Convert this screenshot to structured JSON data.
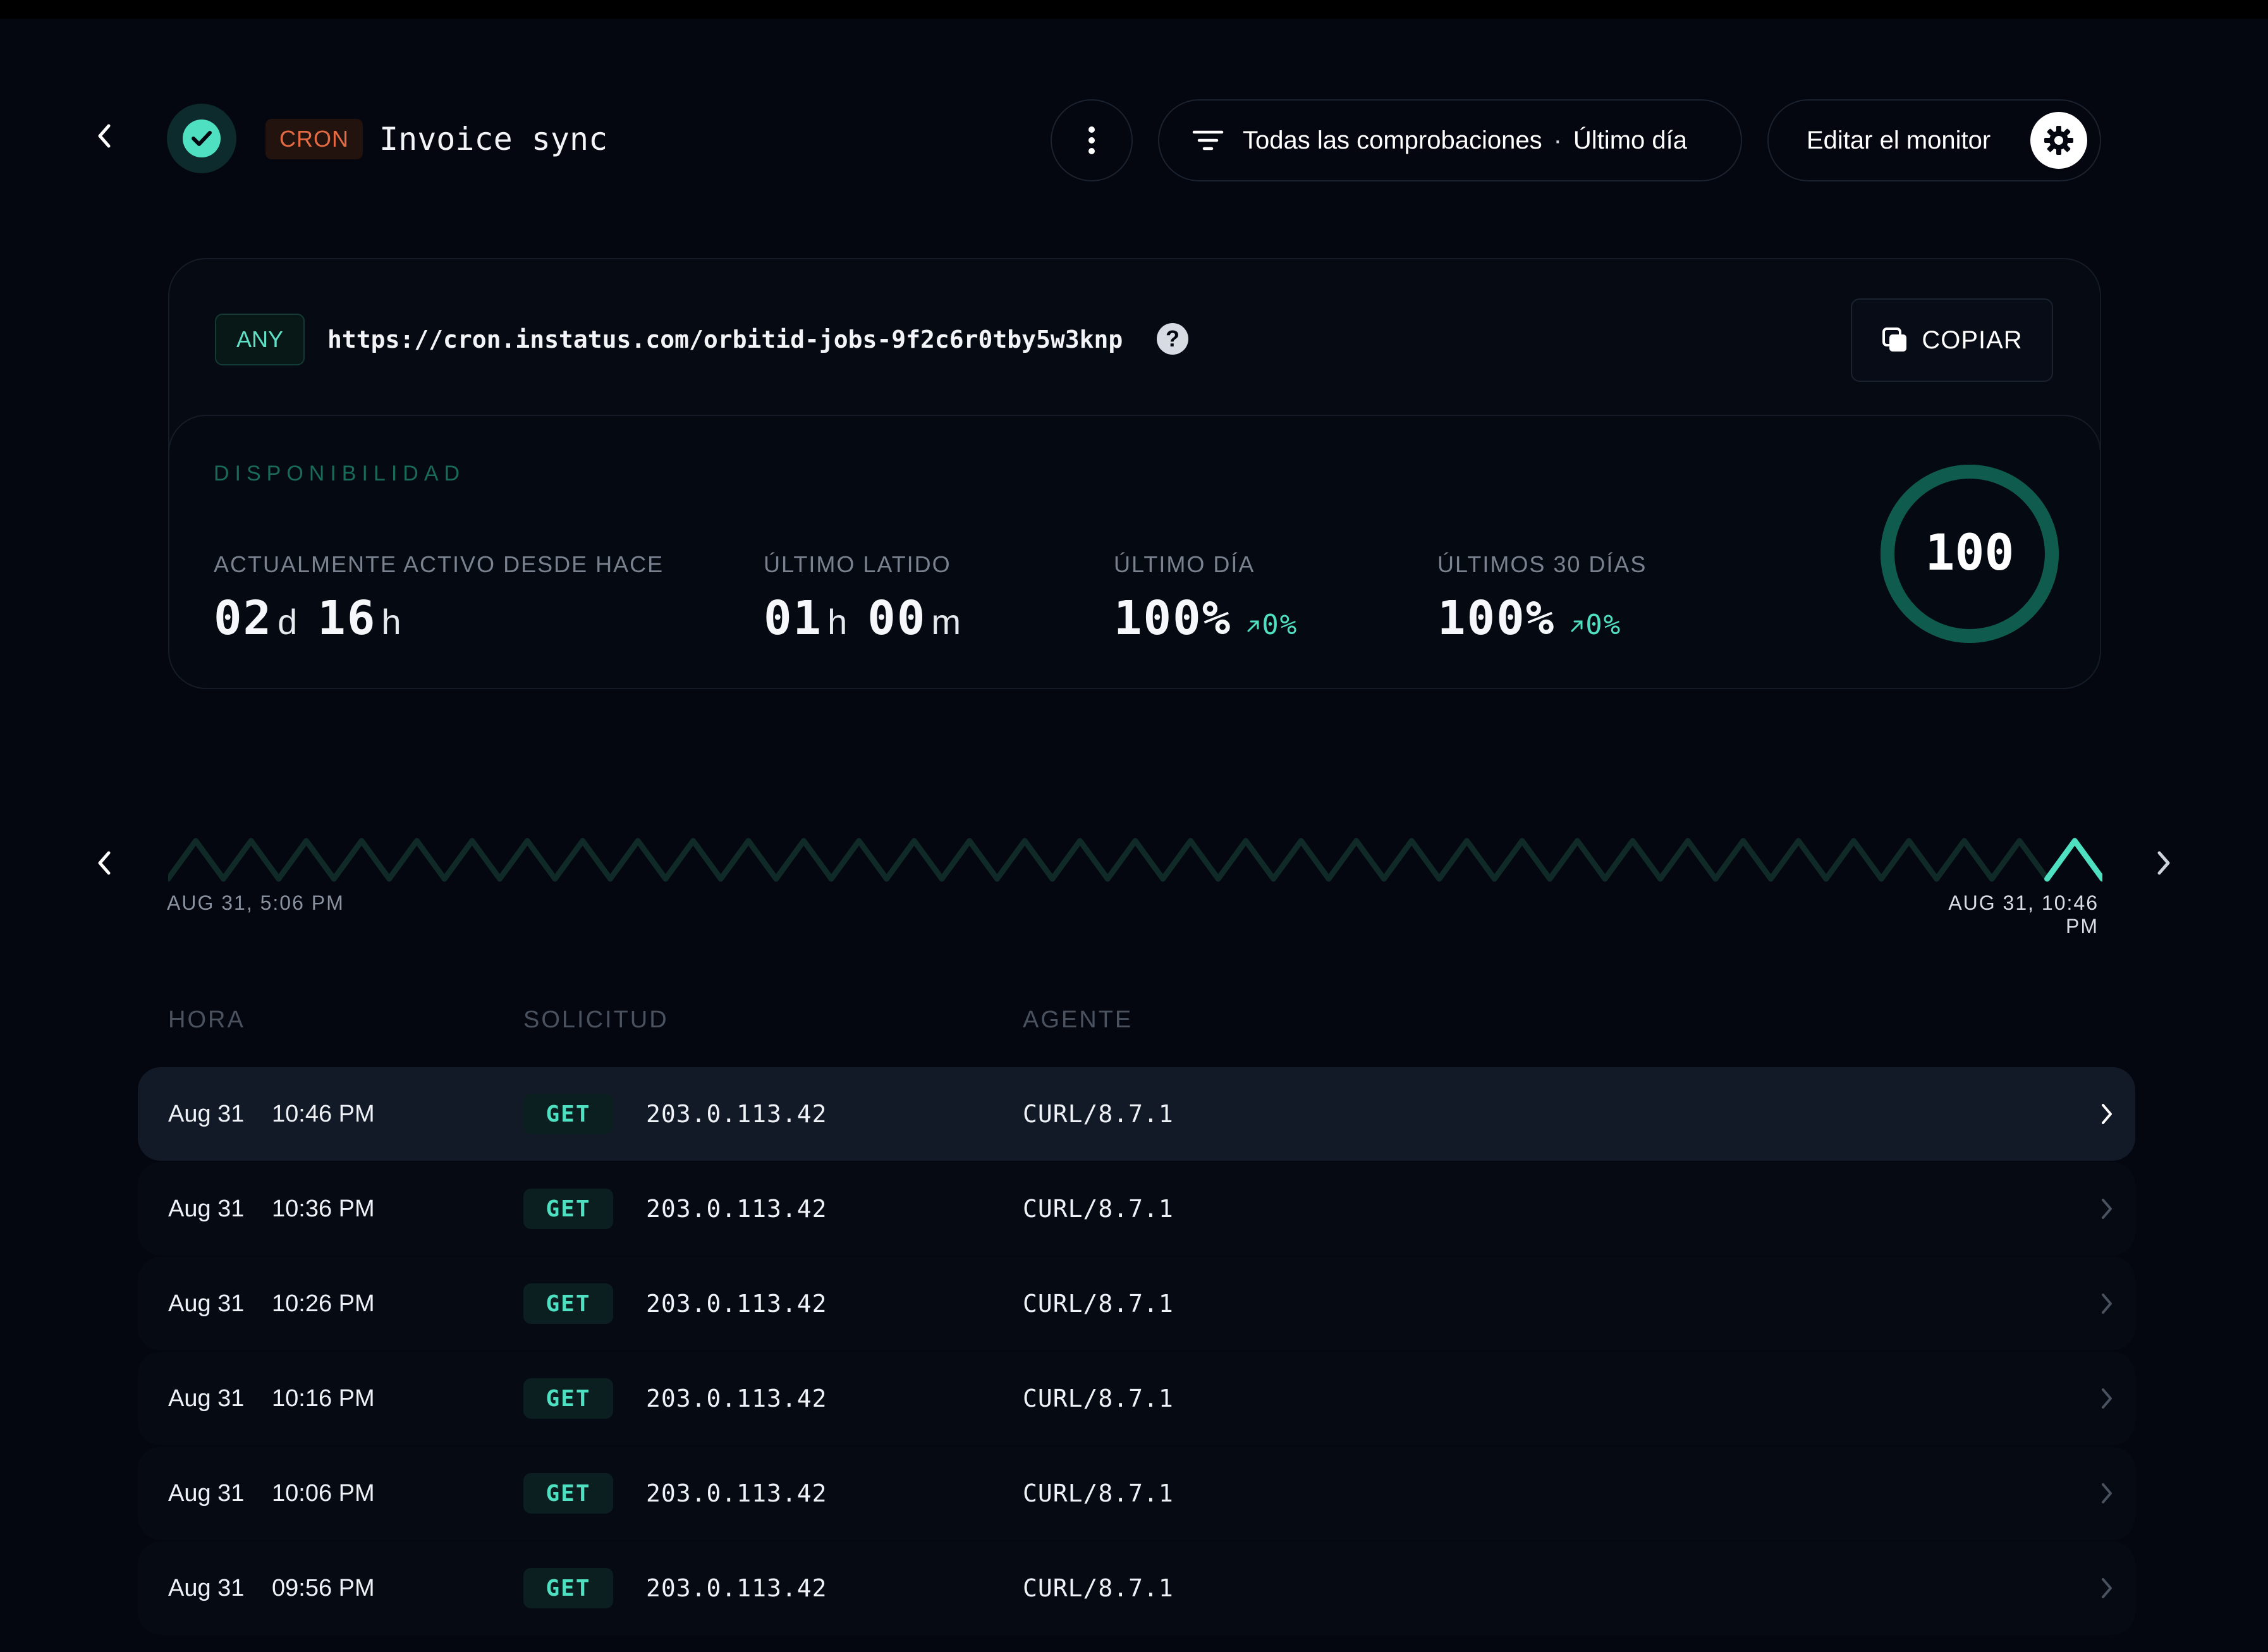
{
  "header": {
    "status": "up",
    "type_badge": "CRON",
    "title": "Invoice sync",
    "filter": {
      "scope": "Todas las comprobaciones",
      "separator": "·",
      "range": "Último día"
    },
    "edit_label": "Editar el monitor"
  },
  "endpoint": {
    "method_badge": "ANY",
    "url": "https://cron.instatus.com/orbitid-jobs-9f2c6r0tby5w3knp",
    "help_symbol": "?",
    "copy_label": "COPIAR"
  },
  "availability": {
    "section_label": "DISPONIBILIDAD",
    "active_since": {
      "label": "ACTUALMENTE ACTIVO DESDE HACE",
      "days": "02",
      "days_unit": "d",
      "hours": "16",
      "hours_unit": "h"
    },
    "last_heartbeat": {
      "label": "ÚLTIMO LATIDO",
      "hours": "01",
      "hours_unit": "h",
      "minutes": "00",
      "minutes_unit": "m"
    },
    "last_day": {
      "label": "ÚLTIMO DÍA",
      "value": "100%",
      "delta": "0%"
    },
    "last_30_days": {
      "label": "ÚLTIMOS 30 DÍAS",
      "value": "100%",
      "delta": "0%"
    },
    "gauge_value": "100",
    "gauge_fraction": 1.0
  },
  "timeline": {
    "start_label": "AUG 31, 5:06 PM",
    "end_label": "AUG 31, 10:46 PM",
    "beat_count": 35,
    "highlighted_beat": "last"
  },
  "table": {
    "headers": {
      "time": "HORA",
      "request": "SOLICITUD",
      "agent": "AGENTE"
    },
    "rows": [
      {
        "date": "Aug 31",
        "time": "10:46 PM",
        "method": "GET",
        "ip": "203.0.113.42",
        "agent": "CURL/8.7.1"
      },
      {
        "date": "Aug 31",
        "time": "10:36 PM",
        "method": "GET",
        "ip": "203.0.113.42",
        "agent": "CURL/8.7.1"
      },
      {
        "date": "Aug 31",
        "time": "10:26 PM",
        "method": "GET",
        "ip": "203.0.113.42",
        "agent": "CURL/8.7.1"
      },
      {
        "date": "Aug 31",
        "time": "10:16 PM",
        "method": "GET",
        "ip": "203.0.113.42",
        "agent": "CURL/8.7.1"
      },
      {
        "date": "Aug 31",
        "time": "10:06 PM",
        "method": "GET",
        "ip": "203.0.113.42",
        "agent": "CURL/8.7.1"
      },
      {
        "date": "Aug 31",
        "time": "09:56 PM",
        "method": "GET",
        "ip": "203.0.113.42",
        "agent": "CURL/8.7.1"
      }
    ]
  },
  "colors": {
    "background": "#04070f",
    "accent": "#4ee0c0",
    "accent_dim": "#0f3a34",
    "cron_badge": "#e36b43"
  }
}
